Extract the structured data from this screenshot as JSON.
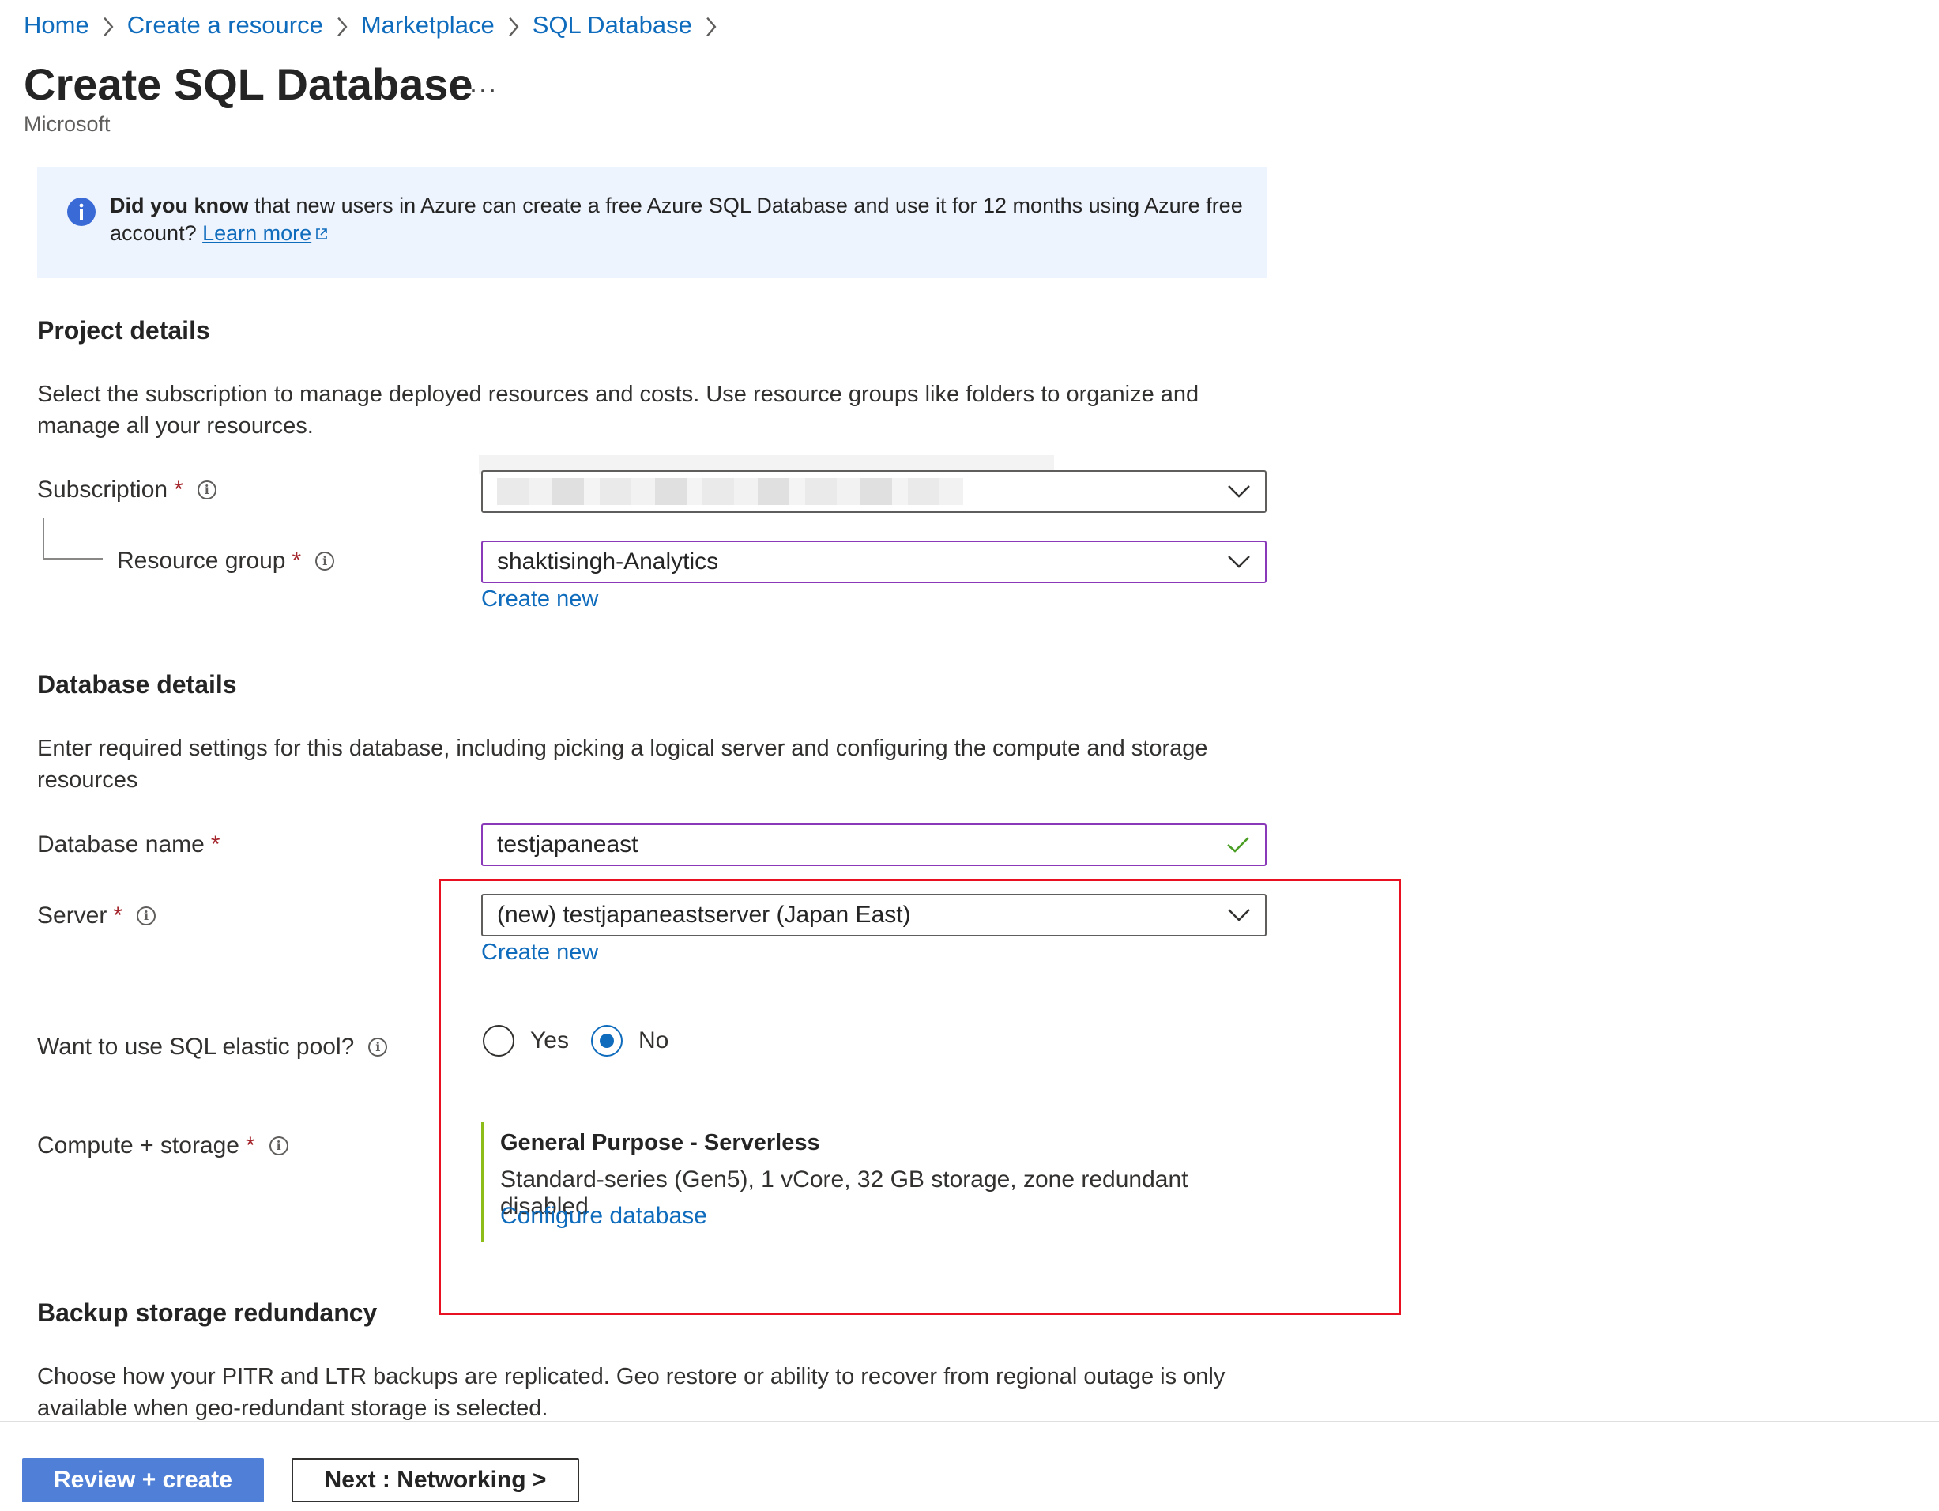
{
  "breadcrumb": {
    "items": [
      "Home",
      "Create a resource",
      "Marketplace",
      "SQL Database"
    ]
  },
  "header": {
    "title": "Create SQL Database",
    "more_label": "...",
    "publisher": "Microsoft"
  },
  "banner": {
    "bold": "Did you know",
    "text": " that new users in Azure can create a free Azure SQL Database and use it for 12 months using Azure free account? ",
    "link": "Learn more"
  },
  "project": {
    "title": "Project details",
    "description": "Select the subscription to manage deployed resources and costs. Use resource groups like folders to organize and manage all your resources.",
    "subscription_label": "Subscription",
    "resource_group_label": "Resource group",
    "resource_group_value": "shaktisingh-Analytics",
    "create_new": "Create new"
  },
  "database": {
    "title": "Database details",
    "description": "Enter required settings for this database, including picking a logical server and configuring the compute and storage resources",
    "name_label": "Database name",
    "name_value": "testjapaneast",
    "server_label": "Server",
    "server_value": "(new) testjapaneastserver (Japan East)",
    "create_new": "Create new",
    "elastic_label": "Want to use SQL elastic pool?",
    "elastic_options": [
      "Yes",
      "No"
    ],
    "elastic_selected": "No",
    "compute_label": "Compute + storage",
    "compute_title": "General Purpose - Serverless",
    "compute_desc": "Standard-series (Gen5), 1 vCore, 32 GB storage, zone redundant disabled",
    "compute_link": "Configure database"
  },
  "backup": {
    "title": "Backup storage redundancy",
    "description": "Choose how your PITR and LTR backups are replicated. Geo restore or ability to recover from regional outage is only available when geo-redundant storage is selected."
  },
  "footer": {
    "review_label": "Review + create",
    "next_label": "Next : Networking >"
  },
  "colors": {
    "link": "#0f6cbd",
    "required": "#a4262c",
    "highlight": "#e81123",
    "primary_button": "#4f7fd6",
    "compute_accent": "#8cbd18"
  },
  "icons": [
    "chevron-right-icon",
    "info-circle-icon",
    "external-link-icon",
    "chevron-down-icon",
    "checkmark-icon"
  ]
}
